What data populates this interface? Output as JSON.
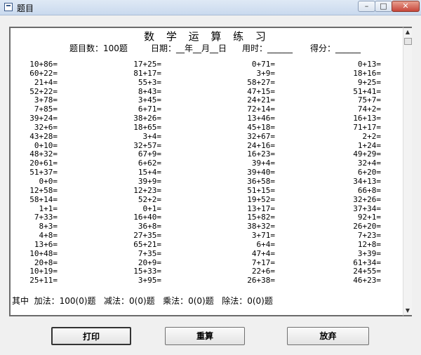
{
  "window": {
    "title": "题目",
    "minimize": "–",
    "maximize": "□",
    "close": "✕"
  },
  "sheet": {
    "title": "数 学 运 算 练 习",
    "count_label": "题目数：100题",
    "date_label": "日期：__年__月__日",
    "time_label": "用时：______",
    "score_label": "得分：______"
  },
  "columns": [
    [
      "10+86=",
      "60+22=",
      "21+4=",
      "52+22=",
      "3+78=",
      "7+85=",
      "39+24=",
      "32+6=",
      "43+28=",
      "0+10=",
      "48+32=",
      "20+61=",
      "51+37=",
      "0+0=",
      "12+58=",
      "58+14=",
      "1+1=",
      "7+33=",
      "8+3=",
      "4+8=",
      "13+6=",
      "10+48=",
      "20+8=",
      "10+19=",
      "25+11="
    ],
    [
      "17+25=",
      "81+17=",
      "55+3=",
      "8+43=",
      "3+45=",
      "6+71=",
      "38+26=",
      "18+65=",
      "3+4=",
      "32+57=",
      "67+9=",
      "6+62=",
      "15+4=",
      "39+9=",
      "12+23=",
      "52+2=",
      "0+1=",
      "16+40=",
      "36+8=",
      "27+35=",
      "65+21=",
      "7+35=",
      "20+9=",
      "15+33=",
      "3+95="
    ],
    [
      "0+71=",
      "3+9=",
      "58+27=",
      "47+15=",
      "24+21=",
      "72+14=",
      "13+46=",
      "45+18=",
      "32+67=",
      "24+16=",
      "16+23=",
      "39+4=",
      "39+40=",
      "36+58=",
      "51+15=",
      "19+52=",
      "13+17=",
      "15+82=",
      "38+32=",
      "3+71=",
      "6+4=",
      "47+4=",
      "7+17=",
      "22+6=",
      "26+38="
    ],
    [
      "0+13=",
      "18+16=",
      "9+25=",
      "51+41=",
      "75+7=",
      "74+2=",
      "16+13=",
      "71+17=",
      "2+2=",
      "1+24=",
      "49+29=",
      "32+4=",
      "6+20=",
      "34+13=",
      "66+8=",
      "32+26=",
      "37+34=",
      "92+1=",
      "26+20=",
      "7+23=",
      "12+8=",
      "3+39=",
      "61+34=",
      "24+55=",
      "46+23="
    ]
  ],
  "summary": {
    "prefix": "其中",
    "add": "加法：100(0)题",
    "sub": "减法：0(0)题",
    "mul": "乘法：0(0)题",
    "div": "除法：0(0)题"
  },
  "buttons": {
    "print": "打印",
    "recalc": "重算",
    "quit": "放弃"
  },
  "scrollbar": {
    "up": "▲",
    "down": "▼"
  }
}
